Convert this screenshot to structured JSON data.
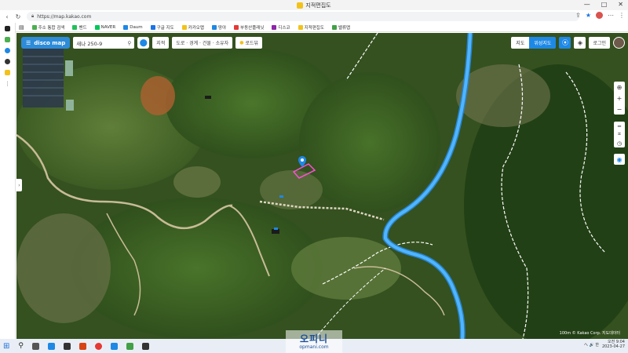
{
  "window": {
    "title": "지적편집도",
    "controls": [
      "—",
      "□",
      "✕"
    ]
  },
  "browser": {
    "url": "https://map.kakao.com",
    "bookmarks": [
      {
        "label": "주소 통합 검색",
        "color": "#4caf50"
      },
      {
        "label": "밴드",
        "color": "#21c15a"
      },
      {
        "label": "NAVER",
        "color": "#03c75a"
      },
      {
        "label": "Daum",
        "color": "#1e88e5"
      },
      {
        "label": "구글 지도",
        "color": "#1a73e8"
      },
      {
        "label": "카카오맵",
        "color": "#f2c21a"
      },
      {
        "label": "땅야",
        "color": "#1e88e5"
      },
      {
        "label": "부동산플래닛",
        "color": "#e53935"
      },
      {
        "label": "디스코",
        "color": "#8e24aa"
      },
      {
        "label": "지적편집도",
        "color": "#f2c21a"
      },
      {
        "label": "밸류맵",
        "color": "#43a047"
      }
    ]
  },
  "map": {
    "logo": "disco map",
    "search_value": "새나 250-9",
    "chips": [
      "지적",
      "도로 · 경계 · 건물 · 소유자",
      "로드뷰"
    ],
    "view_toggle": {
      "off": "지도",
      "on": "위성지도"
    },
    "account_label": "로그인",
    "scale_text": "100m © Kakao Corp. 지도데이터"
  },
  "colors": {
    "accent": "#1e88e5",
    "parcel": "#ff4fd8",
    "road": "#4fb5ff"
  },
  "taskbar": {
    "tray_text": "へ 🔊 한",
    "time": "오전 9:04",
    "date": "2023-04-27"
  },
  "watermark": {
    "top": "오피니",
    "bottom": "opmani.com"
  }
}
